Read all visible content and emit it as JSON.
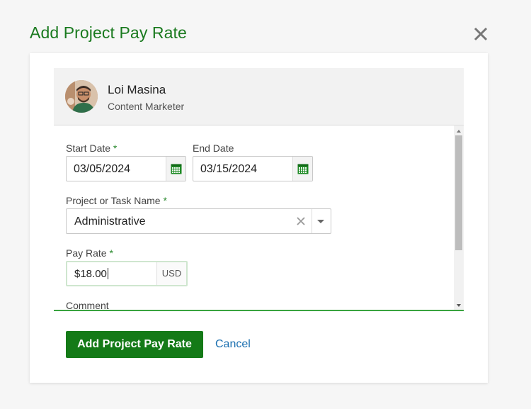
{
  "dialog": {
    "title": "Add Project Pay Rate",
    "close_icon": "close-icon"
  },
  "person": {
    "name": "Loi Masina",
    "role": "Content Marketer",
    "avatar": "avatar-photo"
  },
  "form": {
    "start_date": {
      "label": "Start Date",
      "required_mark": "*",
      "value": "03/05/2024",
      "icon": "calendar-icon"
    },
    "end_date": {
      "label": "End Date",
      "value": "03/15/2024",
      "icon": "calendar-icon"
    },
    "project": {
      "label": "Project or Task Name",
      "required_mark": "*",
      "value": "Administrative",
      "clear_icon": "clear-icon",
      "dropdown_icon": "chevron-down-icon"
    },
    "pay_rate": {
      "label": "Pay Rate",
      "required_mark": "*",
      "value": "$18.00",
      "currency": "USD"
    },
    "comment": {
      "label": "Comment"
    }
  },
  "actions": {
    "submit_label": "Add Project Pay Rate",
    "cancel_label": "Cancel"
  },
  "colors": {
    "brand_green": "#1a7a1f",
    "button_green": "#147a17",
    "link_blue": "#1a6fb0",
    "focus_line": "#39a33f"
  }
}
